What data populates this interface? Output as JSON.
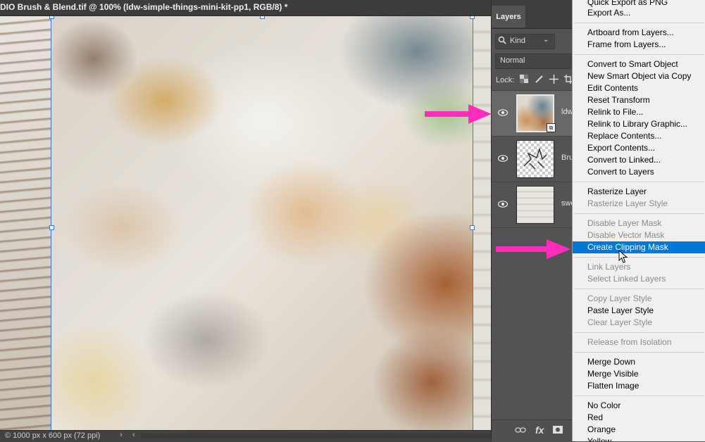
{
  "document": {
    "title": "DIO Brush & Blend.tif @ 100% (ldw-simple-things-mini-kit-pp1, RGB/8) *"
  },
  "status_bar": {
    "info": "© 1000 px x 600 px (72 ppi)",
    "next_arrow": "›",
    "prev_arrow": "‹"
  },
  "layers_panel": {
    "tab_label": "Layers",
    "filter": {
      "icon": "search-icon",
      "label": "Kind",
      "chevron": "⌄"
    },
    "blend_mode": "Normal",
    "lock_label": "Lock:",
    "layers": [
      {
        "name": "ldw",
        "visible": true,
        "selected": true,
        "thumbnail": "paper-art",
        "smart_object": true
      },
      {
        "name": "Bru",
        "visible": true,
        "selected": false,
        "thumbnail": "brush-transparent",
        "smart_object": false
      },
      {
        "name": "swe",
        "visible": true,
        "selected": false,
        "thumbnail": "wood",
        "smart_object": false
      }
    ],
    "footer_icons": [
      "link-icon",
      "fx-icon",
      "mask-icon"
    ]
  },
  "context_menu": {
    "groups": [
      [
        {
          "label": "Quick Export as PNG",
          "enabled": true
        },
        {
          "label": "Export As...",
          "enabled": true
        }
      ],
      [
        {
          "label": "Artboard from Layers...",
          "enabled": true
        },
        {
          "label": "Frame from Layers...",
          "enabled": true
        }
      ],
      [
        {
          "label": "Convert to Smart Object",
          "enabled": true
        },
        {
          "label": "New Smart Object via Copy",
          "enabled": true
        },
        {
          "label": "Edit Contents",
          "enabled": true
        },
        {
          "label": "Reset Transform",
          "enabled": true
        },
        {
          "label": "Relink to File...",
          "enabled": true
        },
        {
          "label": "Relink to Library Graphic...",
          "enabled": true
        },
        {
          "label": "Replace Contents...",
          "enabled": true
        },
        {
          "label": "Export Contents...",
          "enabled": true
        },
        {
          "label": "Convert to Linked...",
          "enabled": true
        },
        {
          "label": "Convert to Layers",
          "enabled": true
        }
      ],
      [
        {
          "label": "Rasterize Layer",
          "enabled": true
        },
        {
          "label": "Rasterize Layer Style",
          "enabled": false
        }
      ],
      [
        {
          "label": "Disable Layer Mask",
          "enabled": false
        },
        {
          "label": "Disable Vector Mask",
          "enabled": false
        },
        {
          "label": "Create Clipping Mask",
          "enabled": true,
          "highlighted": true
        }
      ],
      [
        {
          "label": "Link Layers",
          "enabled": false
        },
        {
          "label": "Select Linked Layers",
          "enabled": false
        }
      ],
      [
        {
          "label": "Copy Layer Style",
          "enabled": false
        },
        {
          "label": "Paste Layer Style",
          "enabled": true
        },
        {
          "label": "Clear Layer Style",
          "enabled": false
        }
      ],
      [
        {
          "label": "Release from Isolation",
          "enabled": false
        }
      ],
      [
        {
          "label": "Merge Down",
          "enabled": true
        },
        {
          "label": "Merge Visible",
          "enabled": true
        },
        {
          "label": "Flatten Image",
          "enabled": true
        }
      ],
      [
        {
          "label": "No Color",
          "enabled": true
        },
        {
          "label": "Red",
          "enabled": true
        },
        {
          "label": "Orange",
          "enabled": true
        },
        {
          "label": "Yellow",
          "enabled": true
        }
      ]
    ]
  },
  "colors": {
    "selection_blue": "#0078d7",
    "annotation_arrow": "#ff2dbd",
    "panel_bg": "#535353"
  }
}
